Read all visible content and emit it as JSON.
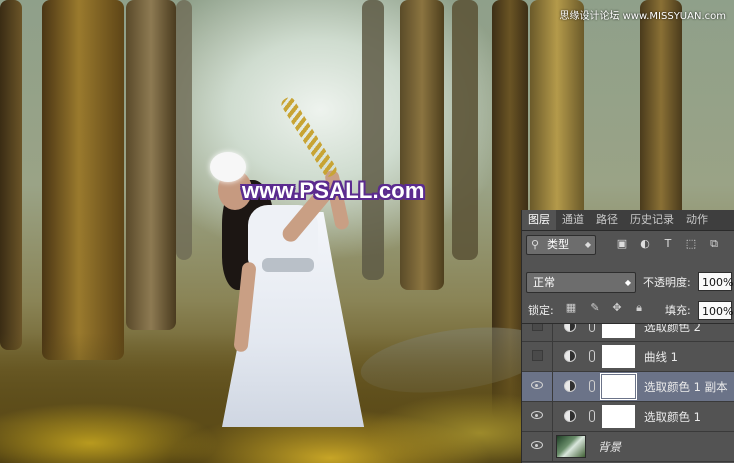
{
  "watermark": {
    "text": "www.PSALL.com",
    "site_tag": "思缘设计论坛 www.MISSYUAN.com"
  },
  "layers_panel": {
    "tabs": [
      {
        "label": "图层",
        "active": true
      },
      {
        "label": "通道",
        "active": false
      },
      {
        "label": "路径",
        "active": false
      },
      {
        "label": "历史记录",
        "active": false
      },
      {
        "label": "动作",
        "active": false
      }
    ],
    "filter": {
      "kind_label": "类型",
      "search_icon": "search-icon",
      "icons": [
        "image-filter-icon",
        "adjustment-filter-icon",
        "type-filter-icon",
        "shape-filter-icon",
        "smart-object-filter-icon"
      ]
    },
    "blend_mode": "正常",
    "opacity": {
      "label": "不透明度:",
      "value": "100%"
    },
    "lock": {
      "label": "锁定:",
      "icons": [
        "lock-transparent-icon",
        "lock-paint-icon",
        "lock-move-icon",
        "lock-all-icon"
      ]
    },
    "fill": {
      "label": "填充:",
      "value": "100%"
    },
    "layers": [
      {
        "name": "选取颜色 2",
        "visible": false,
        "selected": false
      },
      {
        "name": "曲线 1",
        "visible": false,
        "selected": false
      },
      {
        "name": "选取颜色 1 副本",
        "visible": true,
        "selected": true
      },
      {
        "name": "选取颜色 1",
        "visible": true,
        "selected": false
      },
      {
        "name": "背景",
        "visible": true,
        "selected": false,
        "background": true
      }
    ]
  },
  "colors": {
    "panel_bg": "#535353",
    "selected_layer": "#6b7388",
    "watermark_outline": "#5b2b8f"
  }
}
